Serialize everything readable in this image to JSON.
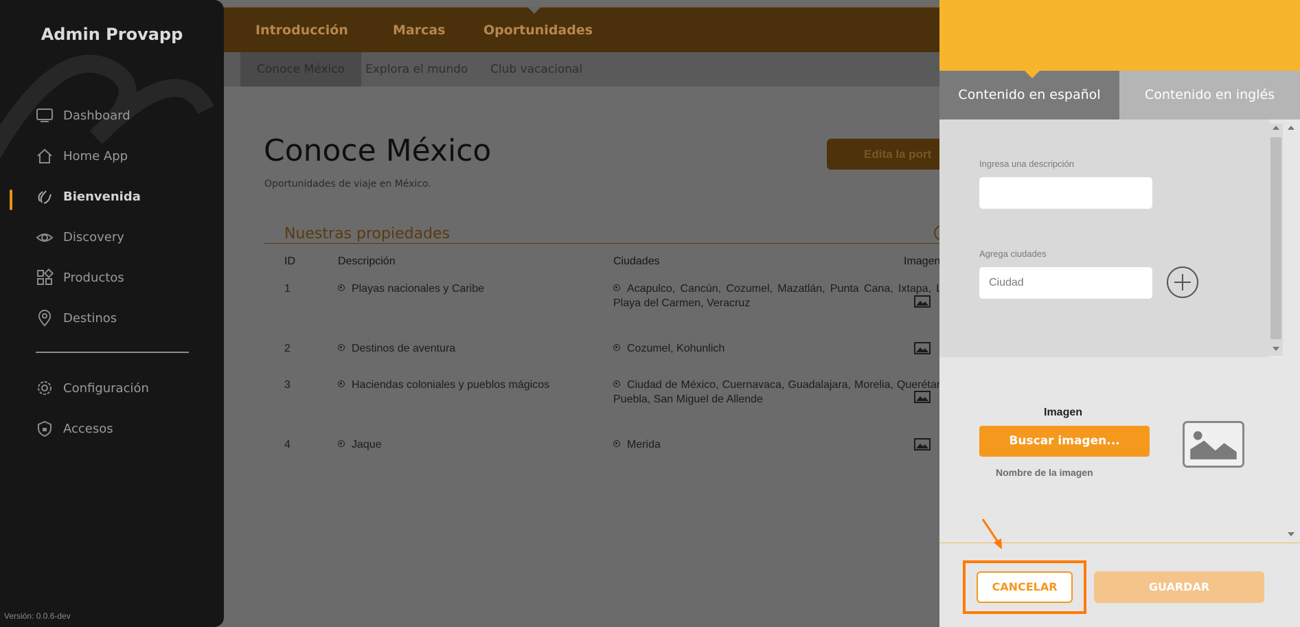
{
  "app": {
    "title": "Admin Provapp",
    "version": "Versión: 0.0.6-dev"
  },
  "sidebar": {
    "items": [
      {
        "label": "Dashboard",
        "icon": "monitor-icon"
      },
      {
        "label": "Home App",
        "icon": "home-icon"
      },
      {
        "label": "Bienvenida",
        "icon": "wave-hand-icon",
        "active": true
      },
      {
        "label": "Discovery",
        "icon": "eye-icon"
      },
      {
        "label": "Productos",
        "icon": "grid-icon"
      },
      {
        "label": "Destinos",
        "icon": "location-pin-icon"
      }
    ],
    "bottom_items": [
      {
        "label": "Configuración",
        "icon": "gear-icon"
      },
      {
        "label": "Accesos",
        "icon": "shield-lock-icon"
      }
    ]
  },
  "topnav": {
    "tabs": [
      "Introducción",
      "Marcas",
      "Oportunidades"
    ],
    "active_tab": "Oportunidades"
  },
  "subnav": {
    "tabs": [
      "Conoce México",
      "Explora el mundo",
      "Club vacacional"
    ],
    "active_tab": "Conoce México"
  },
  "main": {
    "title": "Conoce México",
    "subtitle": "Oportunidades de viaje en México.",
    "edit_button": "Edita la port",
    "section_title": "Nuestras propiedades",
    "table": {
      "headers": [
        "ID",
        "Descripción",
        "Ciudades",
        "Imagen"
      ],
      "rows": [
        {
          "id": "1",
          "description": "Playas nacionales y Caribe",
          "cities": "Acapulco, Cancún, Cozumel, Mazatlán, Punta Cana, Ixtapa, Los Cabos, Playa del Carmen, Veracruz"
        },
        {
          "id": "2",
          "description": "Destinos de aventura",
          "cities": "Cozumel, Kohunlich"
        },
        {
          "id": "3",
          "description": "Haciendas coloniales y pueblos mágicos",
          "cities": "Ciudad de México, Cuernavaca, Guadalajara, Morelia, Querétaro, Oaxaca, Puebla, San Miguel de Allende"
        },
        {
          "id": "4",
          "description": "Jaque",
          "cities": "Merida"
        }
      ]
    }
  },
  "panel": {
    "tabs": {
      "es": "Contenido en español",
      "en": "Contenido en inglés"
    },
    "description_label": "Ingresa una descripción",
    "description_value": "",
    "cities_label": "Agrega ciudades",
    "cities_placeholder": "Ciudad",
    "image_label": "Imagen",
    "browse_button": "Buscar imagen...",
    "image_name": "Nombre de la imagen",
    "cancel_button": "CANCELAR",
    "save_button": "GUARDAR"
  },
  "colors": {
    "accent": "#f5981e",
    "header_yellow": "#f7b52b",
    "highlight": "#ff7a00"
  }
}
